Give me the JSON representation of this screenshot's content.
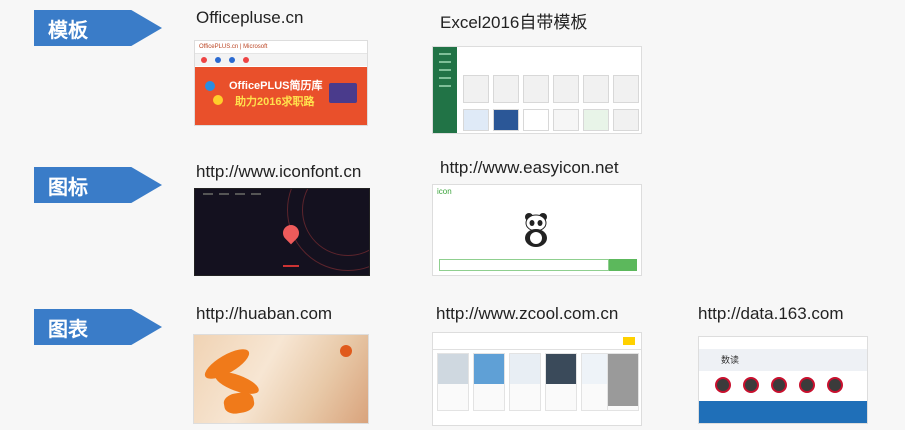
{
  "rows": [
    {
      "label": "模板"
    },
    {
      "label": "图标"
    },
    {
      "label": "图表"
    }
  ],
  "sites": {
    "officeplus": {
      "title": "Officepluse.cn",
      "logo": "OfficePLUS.cn | Microsoft",
      "banner_line1": "OfficePLUS简历库",
      "banner_line2": "助力2016求职路"
    },
    "excel": {
      "title": "Excel2016自带模板"
    },
    "iconfont": {
      "title": "http://www.iconfont.cn"
    },
    "easyicon": {
      "title": "http://www.easyicon.net",
      "logo": "icon"
    },
    "huaban": {
      "title": "http://huaban.com"
    },
    "zcool": {
      "title": "http://www.zcool.com.cn"
    },
    "data163": {
      "title": "http://data.163.com",
      "logo": "数读"
    }
  },
  "colors": {
    "arrow": "#3a7cc8",
    "excel_green": "#217346",
    "office_orange": "#e9502b",
    "huaban_orange": "#f07a1a",
    "zcool_yellow": "#ffd100",
    "netease_red": "#c8102e"
  }
}
